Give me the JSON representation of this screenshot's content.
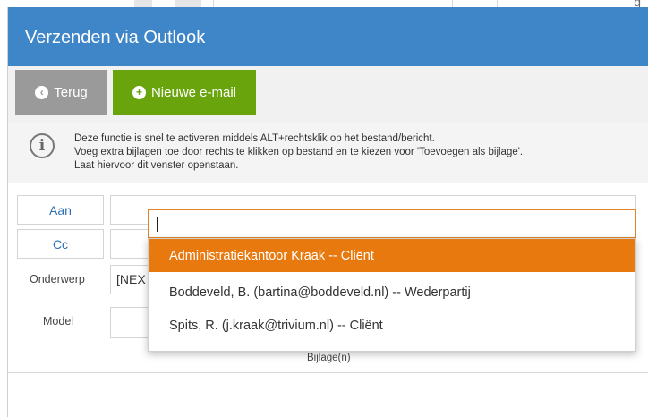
{
  "dialog": {
    "title": "Verzenden via Outlook"
  },
  "toolbar": {
    "back_label": "Terug",
    "back_icon": "chevron-left-circle-icon",
    "new_email_label": "Nieuwe e-mail",
    "new_email_icon": "plus-circle-icon",
    "back_color": "#9a9a9a",
    "new_email_color": "#6aa40d"
  },
  "info": {
    "icon": "info-icon",
    "lines": [
      "Deze functie is snel te activeren middels ALT+rechtsklik op het bestand/bericht.",
      "Voeg extra bijlagen toe door rechts te klikken op bestand en te kiezen voor 'Toevoegen als bijlage'.",
      "Laat hiervoor dit venster openstaan."
    ]
  },
  "form": {
    "to_label": "Aan",
    "cc_label": "Cc",
    "subject_label": "Onderwerp",
    "subject_value": "[NEX",
    "model_label": "Model",
    "attachments_label": "Bijlage(n)"
  },
  "autocomplete": {
    "input_value": "",
    "options": [
      "Administratiekantoor Kraak -- Cliënt",
      "Boddeveld, B. (bartina@boddeveld.nl) -- Wederpartij",
      "Spits, R. (j.kraak@trivium.nl) -- Cliënt"
    ],
    "selected_index": 0,
    "highlight_color": "#e8790f"
  },
  "colors": {
    "titlebar": "#3f86c8",
    "link_blue": "#2d6fb3"
  }
}
